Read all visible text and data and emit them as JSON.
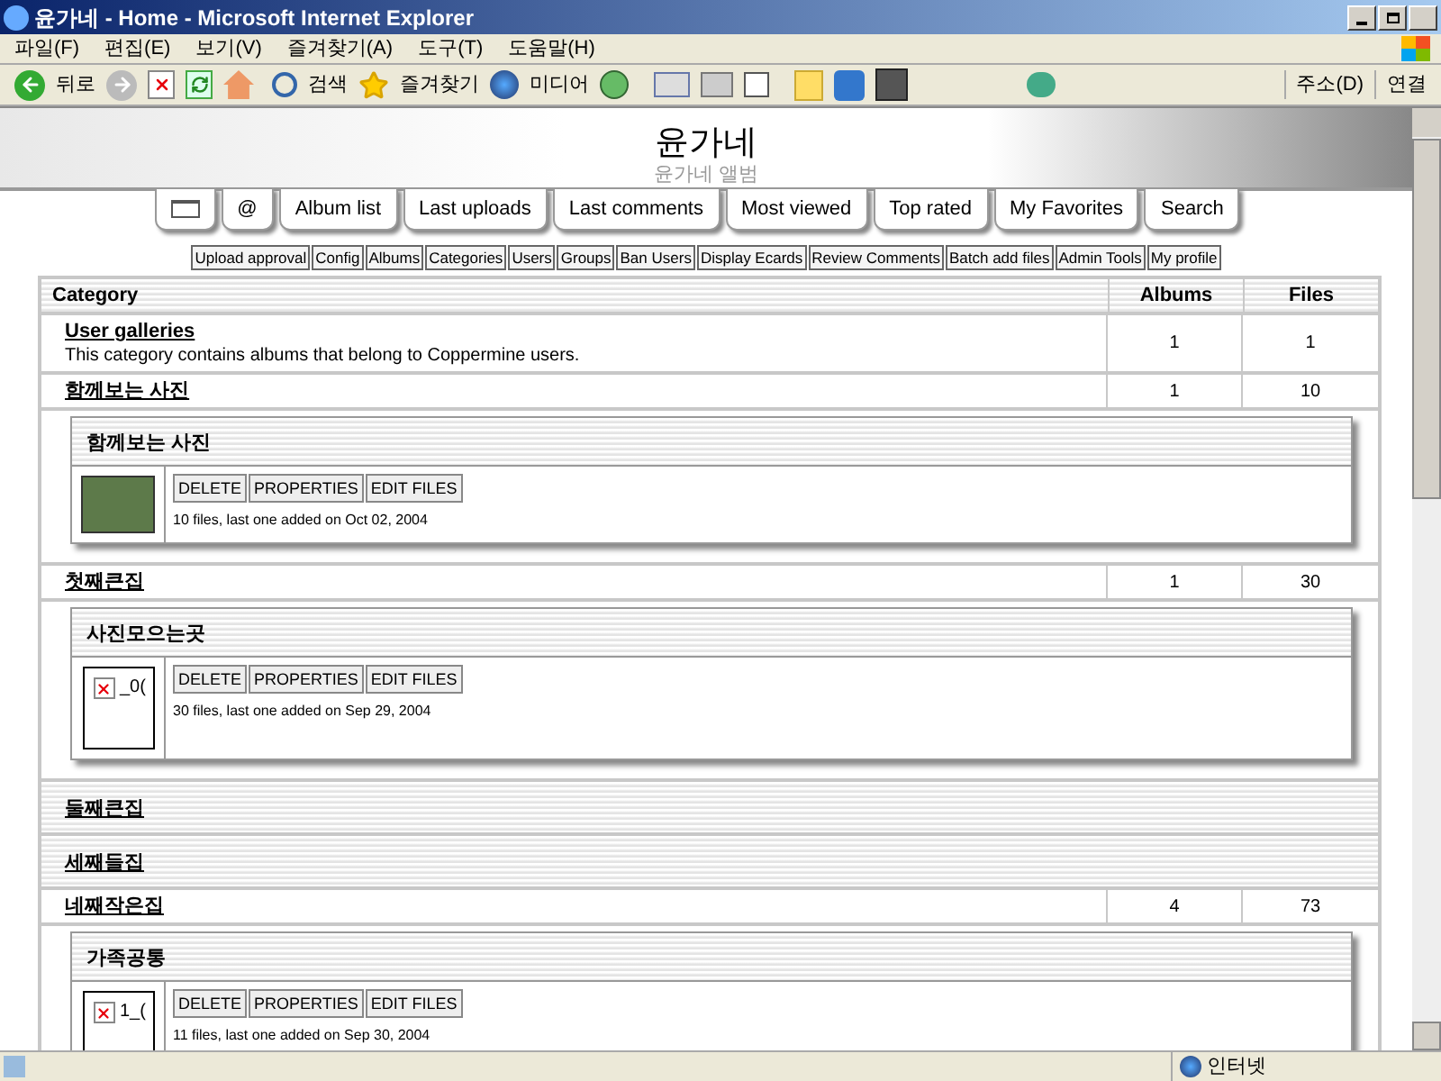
{
  "window": {
    "title": "윤가네 - Home - Microsoft Internet Explorer"
  },
  "menu": [
    "파일(F)",
    "편집(E)",
    "보기(V)",
    "즐겨찾기(A)",
    "도구(T)",
    "도움말(H)"
  ],
  "toolbar": {
    "back": "뒤로",
    "search": "검색",
    "favorites": "즐겨찾기",
    "media": "미디어",
    "address": "주소(D)",
    "links": "연결"
  },
  "header": {
    "title": "윤가네",
    "subtitle": "윤가네 앨범"
  },
  "tabs": [
    {
      "kind": "home"
    },
    {
      "kind": "text",
      "label": "@"
    },
    {
      "kind": "text",
      "label": "Album list"
    },
    {
      "kind": "text",
      "label": "Last uploads"
    },
    {
      "kind": "text",
      "label": "Last comments"
    },
    {
      "kind": "text",
      "label": "Most viewed"
    },
    {
      "kind": "text",
      "label": "Top rated"
    },
    {
      "kind": "text",
      "label": "My Favorites"
    },
    {
      "kind": "text",
      "label": "Search"
    }
  ],
  "admin_links": [
    "Upload approval",
    "Config",
    "Albums",
    "Categories",
    "Users",
    "Groups",
    "Ban Users",
    "Display Ecards",
    "Review Comments",
    "Batch add files",
    "Admin Tools",
    "My profile"
  ],
  "table": {
    "columns": [
      "Category",
      "Albums",
      "Files"
    ],
    "rows": [
      {
        "kind": "category",
        "name": "User galleries",
        "description": "This category contains albums that belong to Coppermine users.",
        "albums": "1",
        "files": "1"
      },
      {
        "kind": "category",
        "name": "함께보는 사진",
        "albums": "1",
        "files": "10"
      },
      {
        "kind": "album",
        "title": "함께보는 사진",
        "buttons": [
          "DELETE",
          "PROPERTIES",
          "EDIT FILES"
        ],
        "info": "10 files, last one added on Oct 02, 2004"
      },
      {
        "kind": "category",
        "name": "첫째큰집",
        "albums": "1",
        "files": "30"
      },
      {
        "kind": "album",
        "title": "사진모으는곳",
        "alt": "_0(",
        "buttons": [
          "DELETE",
          "PROPERTIES",
          "EDIT FILES"
        ],
        "info": "30 files, last one added on Sep 29, 2004"
      },
      {
        "kind": "heading",
        "name": "둘째큰집"
      },
      {
        "kind": "heading",
        "name": "세째들집"
      },
      {
        "kind": "category",
        "name": "네째작은집",
        "albums": "4",
        "files": "73"
      },
      {
        "kind": "album",
        "title": "가족공통",
        "alt": "1_(",
        "buttons": [
          "DELETE",
          "PROPERTIES",
          "EDIT FILES"
        ],
        "info": "11 files, last one added on Sep 30, 2004"
      }
    ]
  },
  "status_bar": {
    "zone": "인터넷"
  }
}
